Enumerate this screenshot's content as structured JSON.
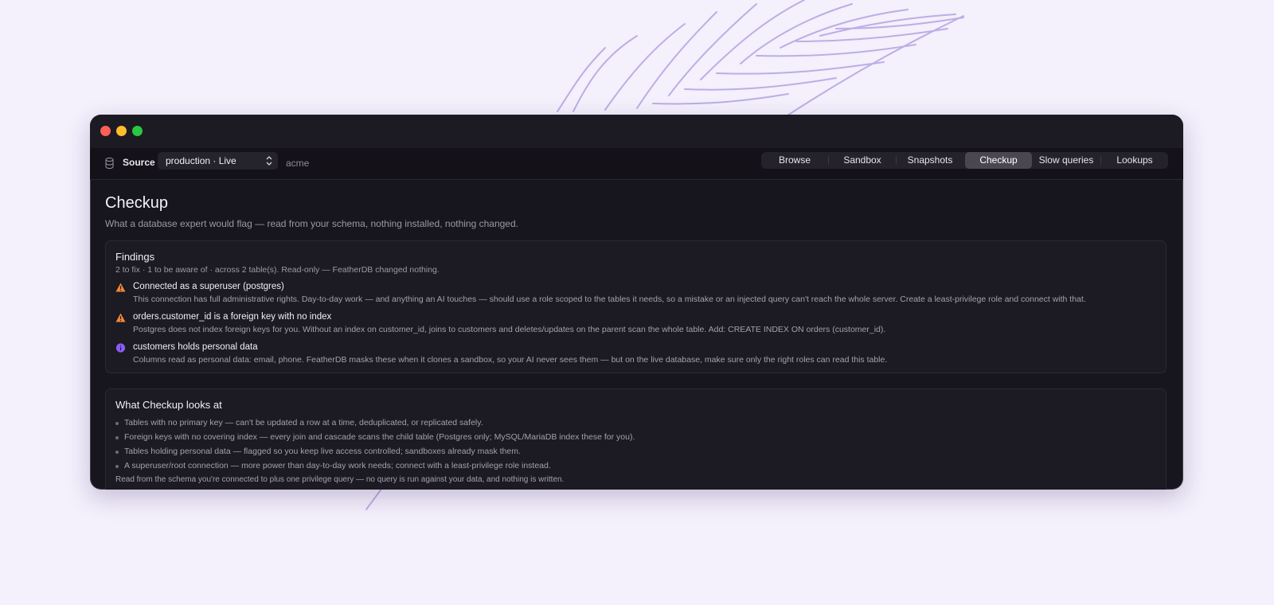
{
  "toolbar": {
    "source_label": "Source",
    "source_value": "production · Live",
    "database": "acme",
    "tabs": [
      {
        "label": "Browse",
        "active": false
      },
      {
        "label": "Sandbox",
        "active": false
      },
      {
        "label": "Snapshots",
        "active": false
      },
      {
        "label": "Checkup",
        "active": true
      },
      {
        "label": "Slow queries",
        "active": false
      },
      {
        "label": "Lookups",
        "active": false
      }
    ]
  },
  "page": {
    "title": "Checkup",
    "subtitle": "What a database expert would flag — read from your schema, nothing installed, nothing changed."
  },
  "findings": {
    "title": "Findings",
    "summary": "2 to fix · 1 to be aware of · across 2 table(s). Read-only — FeatherDB changed nothing.",
    "items": [
      {
        "severity": "warning",
        "icon": "warning-icon",
        "title": "Connected as a superuser (postgres)",
        "description": "This connection has full administrative rights. Day-to-day work — and anything an AI touches — should use a role scoped to the tables it needs, so a mistake or an injected query can't reach the whole server. Create a least-privilege role and connect with that."
      },
      {
        "severity": "warning",
        "icon": "warning-icon",
        "title": "orders.customer_id is a foreign key with no index",
        "description": "Postgres does not index foreign keys for you. Without an index on customer_id, joins to customers and deletes/updates on the parent scan the whole table. Add: CREATE INDEX ON orders (customer_id)."
      },
      {
        "severity": "info",
        "icon": "info-icon",
        "title": "customers holds personal data",
        "description": "Columns read as personal data: email, phone. FeatherDB masks these when it clones a sandbox, so your AI never sees them — but on the live database, make sure only the right roles can read this table."
      }
    ]
  },
  "checkup_scope": {
    "title": "What Checkup looks at",
    "items": [
      "Tables with no primary key — can't be updated a row at a time, deduplicated, or replicated safely.",
      "Foreign keys with no covering index — every join and cascade scans the child table (Postgres only; MySQL/MariaDB index these for you).",
      "Tables holding personal data — flagged so you keep live access controlled; sandboxes already mask them.",
      "A superuser/root connection — more power than day-to-day work needs; connect with a least-privilege role instead."
    ],
    "note": "Read from the schema you're connected to plus one privilege query — no query is run against your data, and nothing is written."
  },
  "colors": {
    "warning": "#f0883a",
    "info": "#8b5cf6",
    "active_tab": "#4a4751",
    "window_bg": "#17151d"
  }
}
